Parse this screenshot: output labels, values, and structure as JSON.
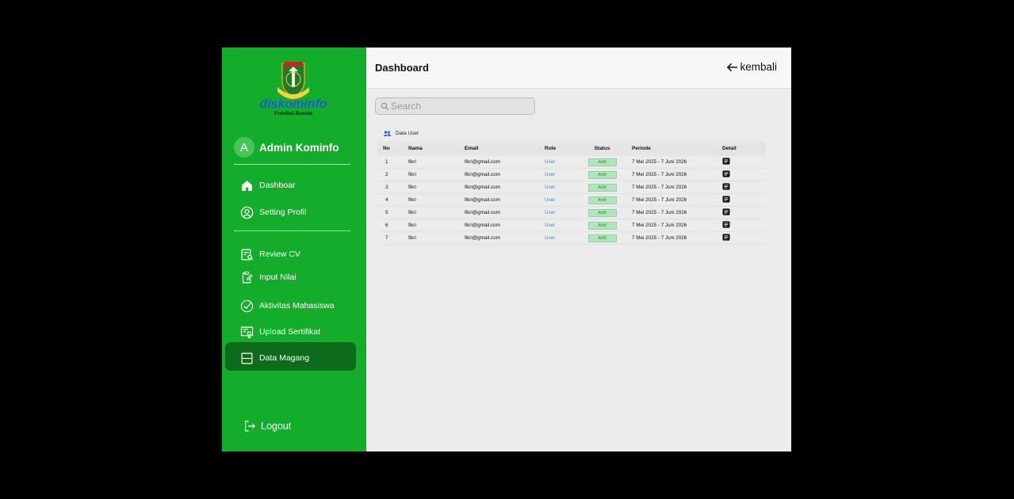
{
  "sidebar": {
    "logo_text": "diskominfo",
    "logo_subtext": "Provinsi Banten",
    "avatar_initial": "A",
    "admin_name": "Admin Kominfo",
    "items": [
      {
        "label": "Dashboar",
        "icon": "home-icon"
      },
      {
        "label": "Setting Profil",
        "icon": "user-circle-icon"
      },
      {
        "label": "Review CV",
        "icon": "cv-review-icon"
      },
      {
        "label": "Input Nilai",
        "icon": "clipboard-edit-icon"
      },
      {
        "label": "Aktivitas Mahasiswa",
        "icon": "check-circle-icon"
      },
      {
        "label": "Upload Sertifikat",
        "icon": "certificate-icon"
      },
      {
        "label": "Data Magang",
        "icon": "layout-icon",
        "active": true
      }
    ],
    "logout_label": "Logout"
  },
  "header": {
    "title": "Dashboard",
    "back_label": "kembali"
  },
  "search": {
    "placeholder": "Search",
    "value": ""
  },
  "table": {
    "caption": "Data User",
    "columns": [
      "No",
      "Nama",
      "Email",
      "Role",
      "Status",
      "Periode",
      "Detail"
    ],
    "rows": [
      {
        "no": "1",
        "nama": "fikri",
        "email": "fikri@gmail.com",
        "role": "User",
        "status": "Aktif",
        "periode": "7 Mei 2025 - 7 Juni 2026"
      },
      {
        "no": "2",
        "nama": "fikri",
        "email": "fikri@gmail.com",
        "role": "User",
        "status": "Aktif",
        "periode": "7 Mei 2025 - 7 Juni 2026"
      },
      {
        "no": "3",
        "nama": "fikri",
        "email": "fikri@gmail.com",
        "role": "User",
        "status": "Aktif",
        "periode": "7 Mei 2025 - 7 Juni 2026"
      },
      {
        "no": "4",
        "nama": "fikri",
        "email": "fikri@gmail.com",
        "role": "User",
        "status": "Aktif",
        "periode": "7 Mei 2025 - 7 Juni 2026"
      },
      {
        "no": "5",
        "nama": "fikri",
        "email": "fikri@gmail.com",
        "role": "User",
        "status": "Aktif",
        "periode": "7 Mei 2025 - 7 Juni 2026"
      },
      {
        "no": "6",
        "nama": "fikri",
        "email": "fikri@gmail.com",
        "role": "User",
        "status": "Aktif",
        "periode": "7 Mei 2025 - 7 Juni 2026"
      },
      {
        "no": "7",
        "nama": "fikri",
        "email": "fikri@gmail.com",
        "role": "User",
        "status": "Aktif",
        "periode": "7 Mei 2025 - 7 Juni 2026"
      }
    ]
  },
  "colors": {
    "sidebar_bg": "#13ad2b",
    "active_item_bg": "#0e6b1c",
    "badge_bg": "#b6e2bf",
    "role_link": "#3a8bd8",
    "main_bg": "#ececec"
  }
}
